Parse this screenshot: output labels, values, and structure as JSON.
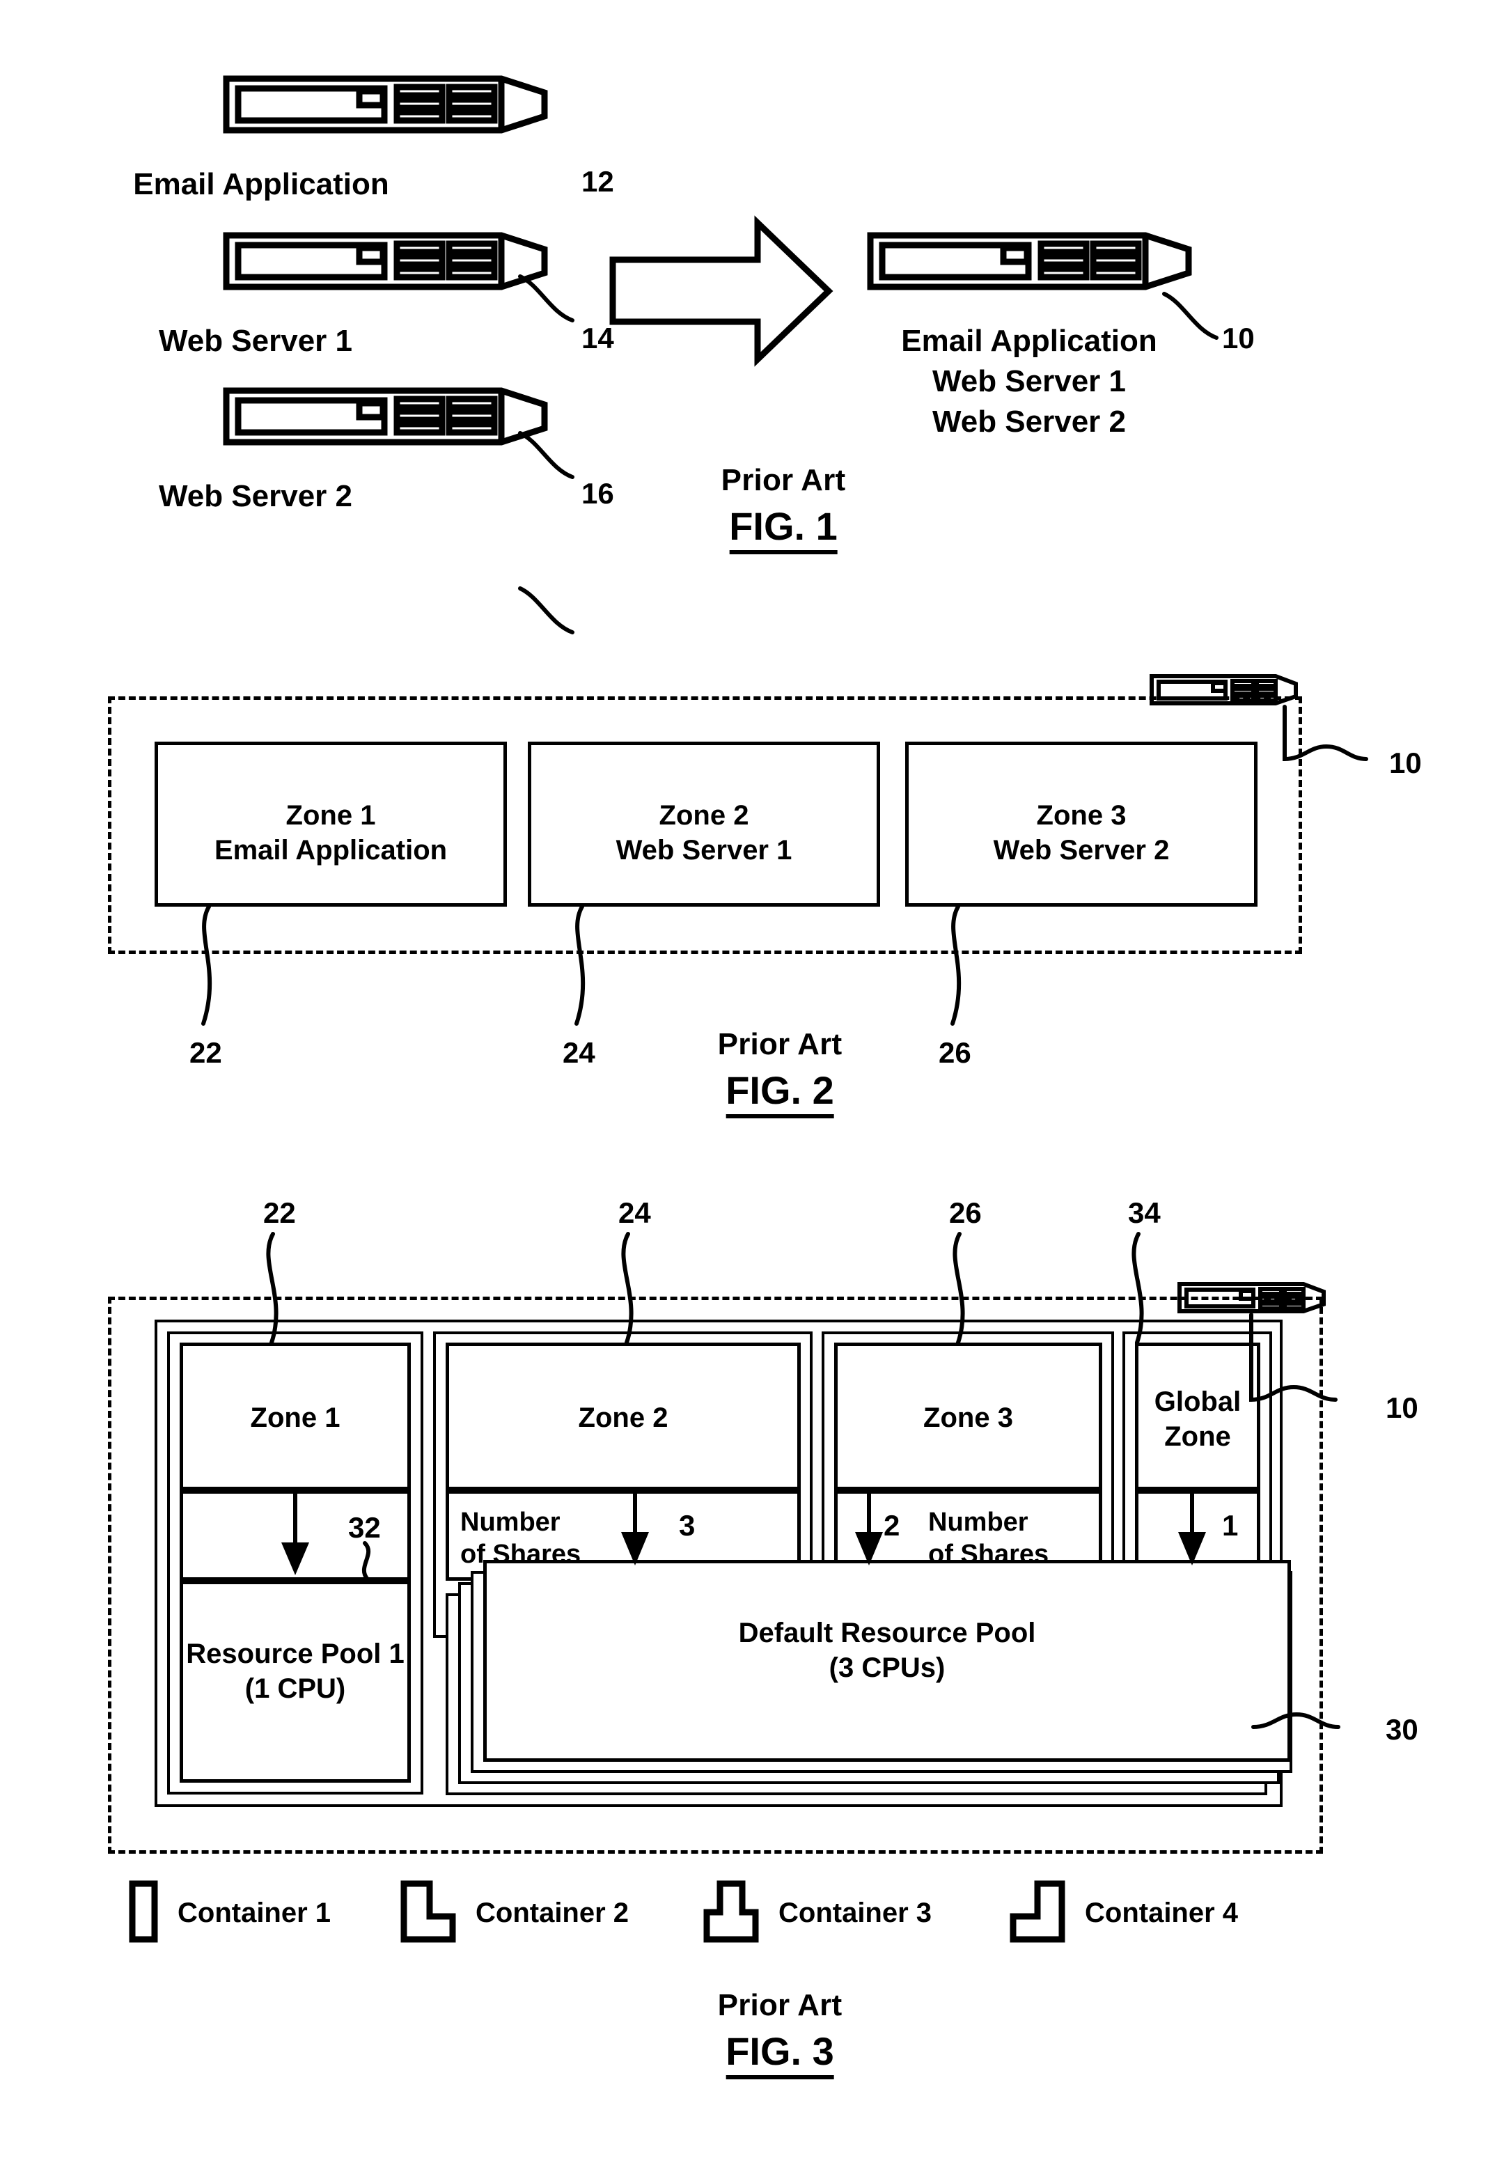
{
  "figures": [
    {
      "id": "fig1",
      "caption_prior_art": "Prior Art",
      "caption_figure": "FIG. 1",
      "source_servers": [
        {
          "label": "Email Application",
          "ref": "12"
        },
        {
          "label": "Web Server 1",
          "ref": "14"
        },
        {
          "label": "Web Server 2",
          "ref": "16"
        }
      ],
      "arrow": "consolidation-arrow",
      "target_server": {
        "ref": "10",
        "labels": [
          "Email Application",
          "Web Server 1",
          "Web Server 2"
        ]
      }
    },
    {
      "id": "fig2",
      "caption_prior_art": "Prior Art",
      "caption_figure": "FIG. 2",
      "host_ref": "10",
      "zones": [
        {
          "title": "Zone 1",
          "subtitle": "Email Application",
          "ref": "22"
        },
        {
          "title": "Zone 2",
          "subtitle": "Web Server 1",
          "ref": "24"
        },
        {
          "title": "Zone 3",
          "subtitle": "Web Server 2",
          "ref": "26"
        }
      ]
    },
    {
      "id": "fig3",
      "caption_prior_art": "Prior Art",
      "caption_figure": "FIG. 3",
      "host_ref": "10",
      "pool_ref": "30",
      "shares_label": "Number\nof Shares",
      "zones": [
        {
          "title": "Zone 1",
          "ref": "22",
          "shares": "",
          "shares_value": "",
          "arrow_ref": "32"
        },
        {
          "title": "Zone 2",
          "ref": "24",
          "shares": "Number\nof Shares",
          "shares_value": "3"
        },
        {
          "title": "Zone 3",
          "ref": "26",
          "shares": "Number\nof Shares",
          "shares_value": "2"
        },
        {
          "title": "Global\nZone",
          "ref": "34",
          "shares": "",
          "shares_value": "1"
        }
      ],
      "pools": [
        {
          "name": "Resource Pool 1",
          "capacity": "(1 CPU)"
        },
        {
          "name": "Default Resource Pool",
          "capacity": "(3 CPUs)"
        }
      ],
      "legend": [
        {
          "shape": "container-1-icon",
          "label": "Container 1"
        },
        {
          "shape": "container-2-icon",
          "label": "Container 2"
        },
        {
          "shape": "container-3-icon",
          "label": "Container 3"
        },
        {
          "shape": "container-4-icon",
          "label": "Container 4"
        }
      ]
    }
  ]
}
